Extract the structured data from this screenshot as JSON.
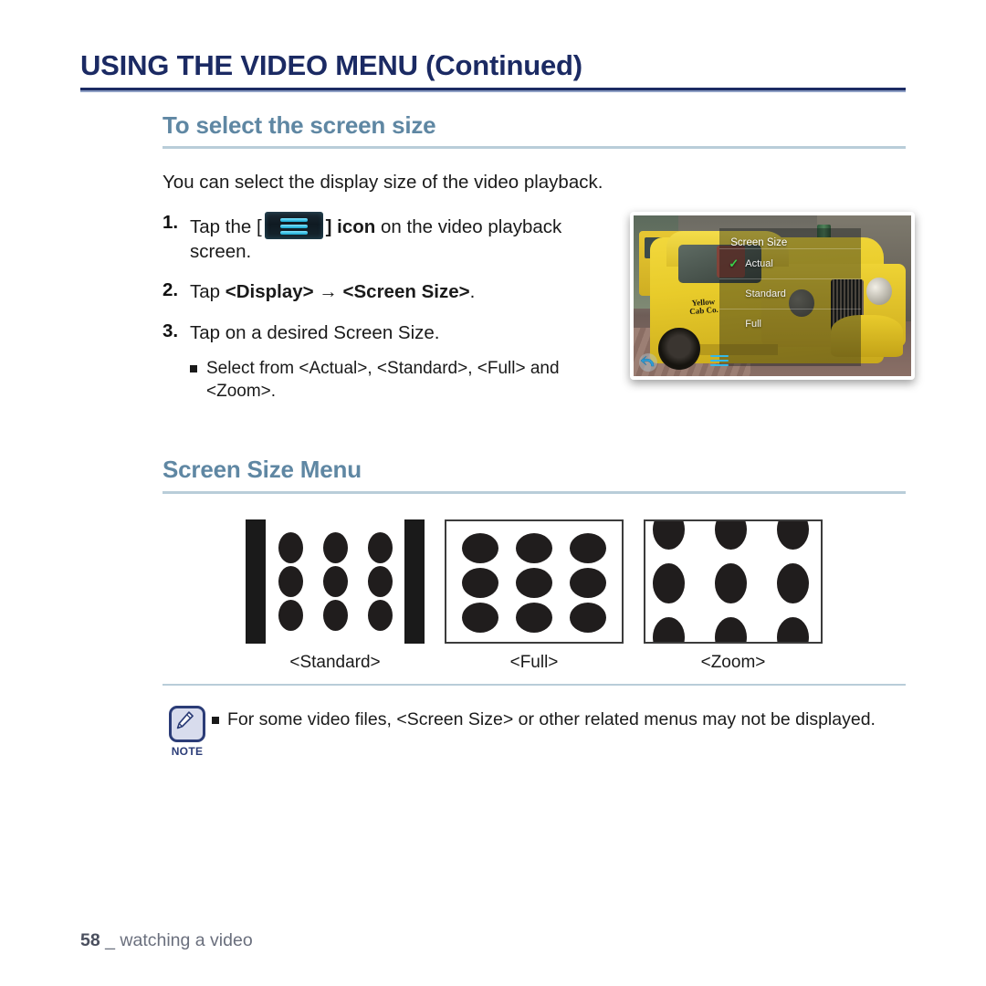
{
  "chapter": {
    "title": "USING THE VIDEO MENU (Continued)"
  },
  "section": {
    "heading": "To select the screen size",
    "intro": "You can select the display size of the video playback."
  },
  "steps": [
    {
      "num": "1.",
      "text_before": "Tap the [",
      "icon": "menu-lines-icon",
      "text_after": "] icon",
      "text_tail": " on the video playback screen."
    },
    {
      "num": "2.",
      "text_plain": "Tap ",
      "bold_a": "<Display>",
      "arrow": "→",
      "bold_b": "<Screen Size>",
      "period": "."
    },
    {
      "num": "3.",
      "text": "Tap on a desired Screen Size.",
      "bullet": "Select from <Actual>, <Standard>, <Full> and <Zoom>."
    }
  ],
  "device_screenshot": {
    "alt_name": "video-playback-screen-with-screen-size-menu",
    "cab_text_line1": "Yellow",
    "cab_text_line2": "Cab Co.",
    "overlay": {
      "title": "Screen Size",
      "items": [
        {
          "label": "Actual",
          "checked": true
        },
        {
          "label": "Standard",
          "checked": false
        },
        {
          "label": "Full",
          "checked": false
        }
      ],
      "check_glyph": "✓",
      "check_color": "#3ad14a"
    },
    "back_icon": "back-arrow-icon",
    "menu_icon": "menu-lines-icon"
  },
  "screen_size_menu": {
    "heading": "Screen Size Menu",
    "diagrams": [
      {
        "label": "<Standard>",
        "type": "standard"
      },
      {
        "label": "<Full>",
        "type": "full"
      },
      {
        "label": "<Zoom>",
        "type": "zoom"
      }
    ]
  },
  "note": {
    "badge_icon": "pen-note-icon",
    "label": "NOTE",
    "text": "For some video files, <Screen Size> or other related menus may not be displayed."
  },
  "footer": {
    "page": "58",
    "separator": "_",
    "label": "watching a video"
  },
  "colors": {
    "chapter_title": "#1b2a63",
    "section_heading": "#5f87a3",
    "rule_light": "#b9cdd9",
    "note_accent": "#2b3c77",
    "footer_text": "#6a6f7d"
  }
}
